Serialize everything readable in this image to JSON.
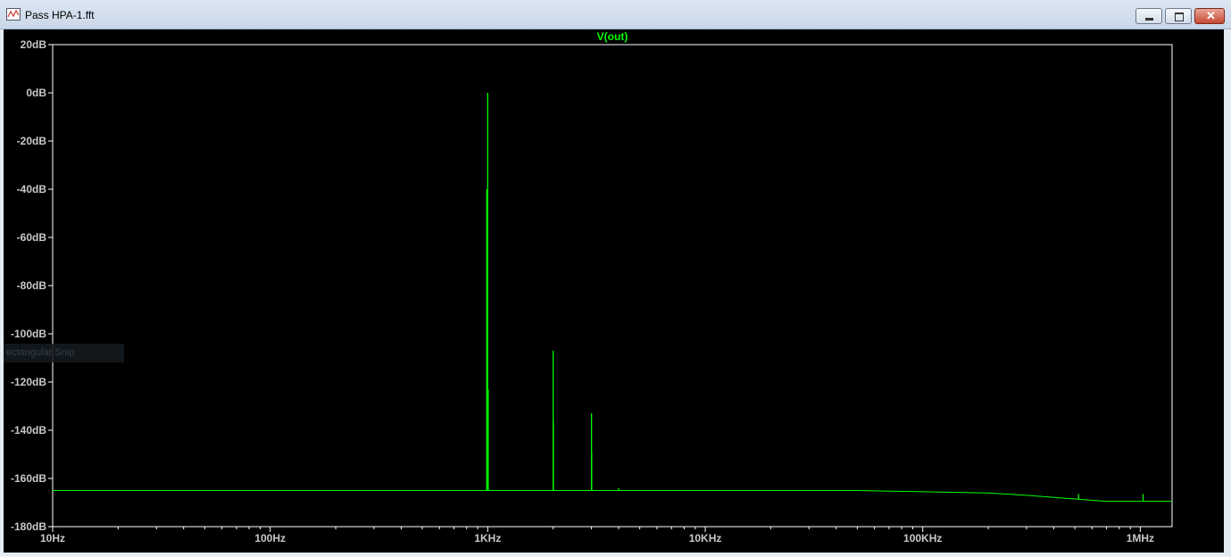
{
  "window": {
    "title": "Pass HPA-1.fft"
  },
  "overlay": {
    "text": "ectangular Snip"
  },
  "colors": {
    "trace": "#00ff00",
    "background": "#000000",
    "axis": "#ffffff",
    "tick_label": "#c8c8c8"
  },
  "chart_data": {
    "type": "line",
    "title": "V(out)",
    "xlabel": "",
    "ylabel": "",
    "x_scale": "log",
    "xlim": [
      10,
      1400000
    ],
    "ylim": [
      -180,
      20
    ],
    "grid": false,
    "x_ticks": [
      {
        "value": 10,
        "label": "10Hz"
      },
      {
        "value": 100,
        "label": "100Hz"
      },
      {
        "value": 1000,
        "label": "1KHz"
      },
      {
        "value": 10000,
        "label": "10KHz"
      },
      {
        "value": 100000,
        "label": "100KHz"
      },
      {
        "value": 1000000,
        "label": "1MHz"
      }
    ],
    "y_ticks": [
      {
        "value": 20,
        "label": "20dB"
      },
      {
        "value": 0,
        "label": "0dB"
      },
      {
        "value": -20,
        "label": "-20dB"
      },
      {
        "value": -40,
        "label": "-40dB"
      },
      {
        "value": -60,
        "label": "-60dB"
      },
      {
        "value": -80,
        "label": "-80dB"
      },
      {
        "value": -100,
        "label": "-100dB"
      },
      {
        "value": -120,
        "label": "-120dB"
      },
      {
        "value": -140,
        "label": "-140dB"
      },
      {
        "value": -160,
        "label": "-160dB"
      },
      {
        "value": -180,
        "label": "-180dB"
      }
    ],
    "series": [
      {
        "name": "V(out)",
        "floor": [
          [
            10,
            -165
          ],
          [
            100,
            -165
          ],
          [
            1000,
            -165
          ],
          [
            10000,
            -165
          ],
          [
            50000,
            -165
          ],
          [
            100000,
            -165.5
          ],
          [
            200000,
            -166
          ],
          [
            300000,
            -167
          ],
          [
            500000,
            -168.5
          ],
          [
            700000,
            -169.5
          ],
          [
            1000000,
            -169.5
          ],
          [
            1400000,
            -169.5
          ]
        ],
        "peaks": [
          {
            "x": 990,
            "y": -40
          },
          {
            "x": 1000,
            "y": 0
          },
          {
            "x": 1005,
            "y": -123
          },
          {
            "x": 2000,
            "y": -107
          },
          {
            "x": 2002,
            "y": -136
          },
          {
            "x": 3000,
            "y": -133
          },
          {
            "x": 3003,
            "y": -149
          },
          {
            "x": 4000,
            "y": -164
          },
          {
            "x": 520000,
            "y": -166.5
          },
          {
            "x": 1030000,
            "y": -166.5
          }
        ]
      }
    ]
  }
}
